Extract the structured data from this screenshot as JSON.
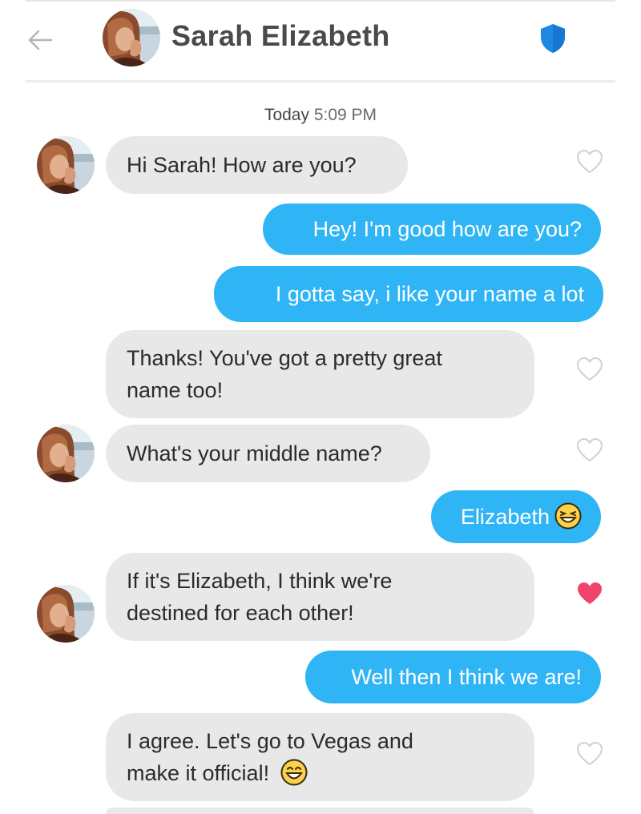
{
  "header": {
    "contact_name": "Sarah Elizabeth",
    "back_icon": "arrow-left-icon",
    "verified_icon": "shield-icon",
    "accent_color": "#1e88e5"
  },
  "timestamp": {
    "day": "Today",
    "time": "5:09 PM"
  },
  "colors": {
    "incoming_bubble": "#e8e8e8",
    "outgoing_bubble": "#2fb4f5",
    "liked_heart": "#f0456a",
    "unliked_heart": "#cfcfcf"
  },
  "messages": [
    {
      "direction": "in",
      "lines": [
        "Hi Sarah!  How are you?"
      ],
      "liked": false
    },
    {
      "direction": "out",
      "lines": [
        "Hey! I'm good how are you?"
      ]
    },
    {
      "direction": "out",
      "lines": [
        "I gotta say, i like your name a lot"
      ]
    },
    {
      "direction": "in",
      "lines": [
        "Thanks!  You've got a pretty great",
        "name too!"
      ],
      "liked": false
    },
    {
      "direction": "in",
      "lines": [
        "What's your middle name?"
      ],
      "liked": false
    },
    {
      "direction": "out",
      "lines": [
        "Elizabeth"
      ],
      "emoji": "laughing-emoji"
    },
    {
      "direction": "in",
      "lines": [
        "If it's Elizabeth, I think we're",
        "destined for each other!"
      ],
      "liked": true
    },
    {
      "direction": "out",
      "lines": [
        "Well then I think we are!"
      ]
    },
    {
      "direction": "in",
      "lines": [
        "I agree.  Let's go to Vegas and",
        "make it official!"
      ],
      "liked": false,
      "emoji": "grinning-emoji"
    }
  ]
}
